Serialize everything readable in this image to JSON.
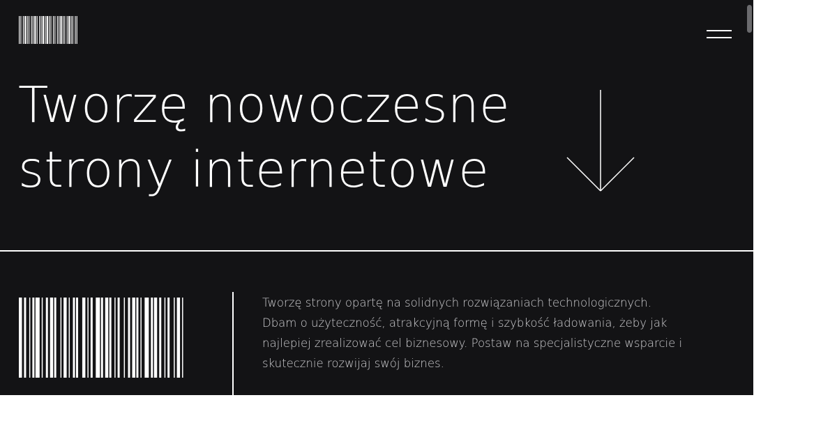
{
  "header": {
    "logo_icon": "barcode-logo-icon",
    "menu_icon": "hamburger-menu-icon"
  },
  "hero": {
    "title_line_1": "Tworzę nowoczesne",
    "title_line_2": "strony internetowe",
    "scroll_icon": "arrow-down-icon"
  },
  "intro": {
    "barcode_icon": "barcode-icon",
    "text_lines": [
      "Tworzę strony opartę na solidnych rozwiązaniach technologicznych.",
      "Dbam o użyteczność, atrakcyjną formę i szybkość ładowania, żeby jak",
      "najlepiej zrealizować cel biznesowy. Postaw na specjalistyczne wsparcie i",
      "skutecznie rozwijaj swój biznes."
    ]
  },
  "colors": {
    "background": "#131315",
    "foreground": "#ffffff",
    "body_text": "#cfcfd2",
    "page_outside": "#ffffff"
  }
}
